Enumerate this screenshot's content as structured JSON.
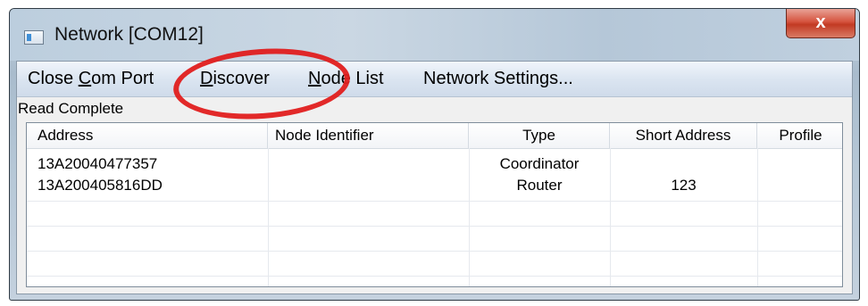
{
  "window": {
    "title": "Network [COM12]",
    "close_glyph": "x"
  },
  "menu": {
    "items": [
      {
        "pre": "Close ",
        "ul": "C",
        "post": "om Port"
      },
      {
        "pre": "",
        "ul": "D",
        "post": "iscover"
      },
      {
        "pre": "",
        "ul": "N",
        "post": "ode List"
      },
      {
        "pre": "Network Settings...",
        "ul": "",
        "post": ""
      }
    ]
  },
  "status": "Read Complete",
  "table": {
    "columns": [
      "Address",
      "Node Identifier",
      "Type",
      "Short Address",
      "Profile"
    ],
    "rows": [
      {
        "address": "13A20040477357",
        "node_identifier": "",
        "type": "Coordinator",
        "short_address": "",
        "profile": ""
      },
      {
        "address": "13A200405816DD",
        "node_identifier": "",
        "type": "Router",
        "short_address": "123",
        "profile": ""
      }
    ]
  },
  "annotation": {
    "color": "#e01e1e",
    "shape": "ellipse-highlight"
  }
}
